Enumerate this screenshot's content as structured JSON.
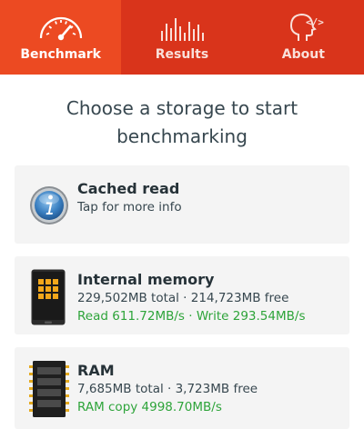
{
  "tabs": [
    {
      "label": "Benchmark",
      "icon": "speedometer-icon",
      "active": true
    },
    {
      "label": "Results",
      "icon": "bar-graph-icon",
      "active": false
    },
    {
      "label": "About",
      "icon": "head-code-icon",
      "active": false
    }
  ],
  "heading": {
    "line1": "Choose a storage to start",
    "line2": "benchmarking"
  },
  "storages": [
    {
      "title": "Cached read",
      "details": "Tap for more info",
      "icon": "info-icon"
    },
    {
      "title": "Internal memory",
      "details": "229,502MB total · 214,723MB free",
      "speeds": "Read 611.72MB/s · Write 293.54MB/s",
      "icon": "phone-memory-icon"
    },
    {
      "title": "RAM",
      "details": "7,685MB total · 3,723MB free",
      "speeds": "RAM copy 4998.70MB/s",
      "icon": "ram-chip-icon"
    }
  ],
  "colors": {
    "tab_bar": "#d9341b",
    "tab_active": "#ec4a22",
    "speed_text": "#2ea43a",
    "card_bg": "#f4f4f4"
  }
}
